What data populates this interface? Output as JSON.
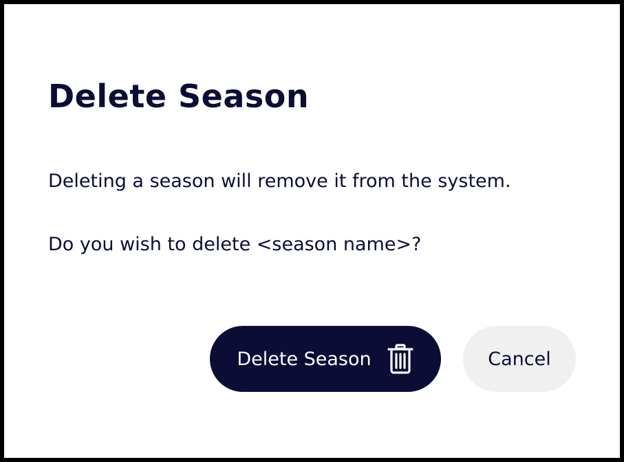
{
  "dialog": {
    "title": "Delete Season",
    "message_line_1": "Deleting a season will remove it from the system.",
    "message_line_2": "Do you wish to delete <season name>?",
    "delete_button": {
      "label": "Delete Season",
      "icon": "trash-icon"
    },
    "cancel_button": {
      "label": "Cancel"
    }
  },
  "colors": {
    "primary": "#0b0d35",
    "cancel_bg": "#f0f0f0",
    "frame": "#000000",
    "surface": "#ffffff"
  }
}
